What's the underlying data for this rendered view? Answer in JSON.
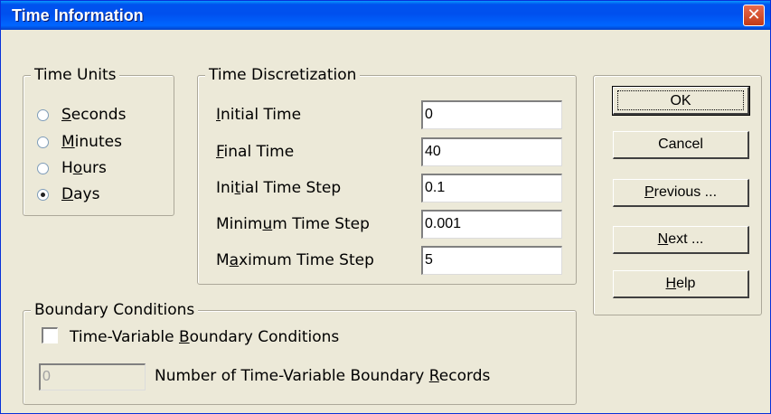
{
  "window": {
    "title": "Time Information",
    "close_glyph": "✕"
  },
  "time_units": {
    "legend": "Time Units",
    "options": [
      {
        "pre": "",
        "key": "S",
        "post": "econds",
        "checked": false
      },
      {
        "pre": "",
        "key": "M",
        "post": "inutes",
        "checked": false
      },
      {
        "pre": "H",
        "key": "o",
        "post": "urs",
        "checked": false
      },
      {
        "pre": "",
        "key": "D",
        "post": "ays",
        "checked": true
      }
    ]
  },
  "time_discretization": {
    "legend": "Time Discretization",
    "fields": [
      {
        "pre": "",
        "key": "I",
        "post": "nitial Time",
        "value": "0"
      },
      {
        "pre": "",
        "key": "F",
        "post": "inal Time",
        "value": "40"
      },
      {
        "pre": "Ini",
        "key": "t",
        "post": "ial Time Step",
        "value": "0.1"
      },
      {
        "pre": "Minim",
        "key": "u",
        "post": "m Time Step",
        "value": "0.001"
      },
      {
        "pre": "M",
        "key": "a",
        "post": "ximum Time Step",
        "value": "5"
      }
    ]
  },
  "buttons": {
    "ok": {
      "pre": "",
      "key": "",
      "post": "OK"
    },
    "cancel": {
      "pre": "",
      "key": "",
      "post": "Cancel"
    },
    "previous": {
      "pre": "",
      "key": "P",
      "post": "revious ..."
    },
    "next": {
      "pre": "",
      "key": "N",
      "post": "ext ..."
    },
    "help": {
      "pre": "",
      "key": "H",
      "post": "elp"
    }
  },
  "boundary_conditions": {
    "legend": "Boundary Conditions",
    "checkbox": {
      "pre": "Time-Variable ",
      "key": "B",
      "post": "oundary Conditions",
      "checked": false
    },
    "records": {
      "value": "0",
      "pre": "Number of Time-Variable Boundary ",
      "key": "R",
      "post": "ecords"
    }
  }
}
